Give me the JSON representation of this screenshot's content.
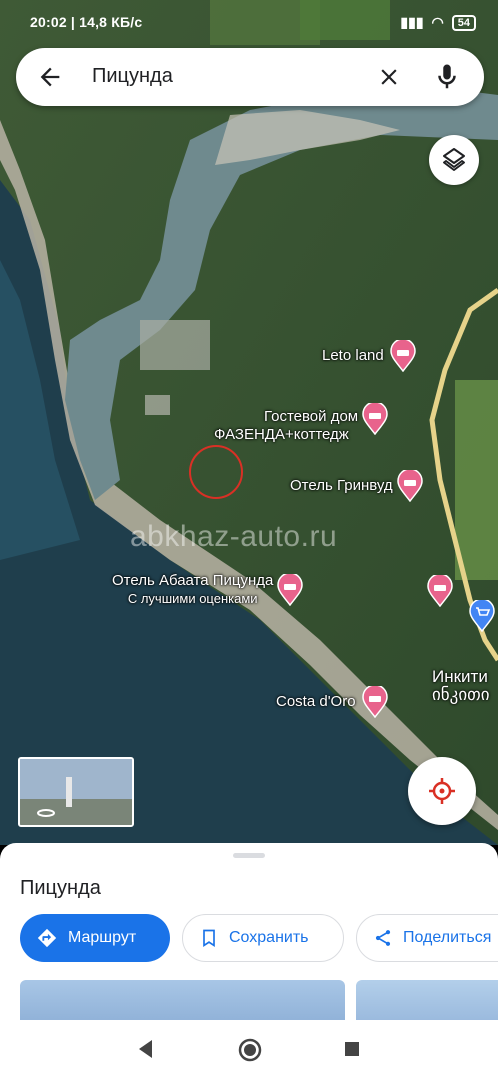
{
  "status_bar": {
    "time_and_speed": "20:02 | 14,8 КБ/с",
    "battery": "54"
  },
  "search": {
    "query": "Пицунда",
    "back_icon": "arrow-left-icon",
    "clear_icon": "close-icon",
    "mic_icon": "mic-icon"
  },
  "map": {
    "watermark": "abkhaz-auto.ru",
    "pois": [
      {
        "label": "Leto land",
        "type": "hotel"
      },
      {
        "label": "Гостевой дом",
        "label2": "ФАЗЕНДА+коттедж",
        "type": "hotel"
      },
      {
        "label": "Отель Гринвуд",
        "type": "hotel"
      },
      {
        "label": "Отель Абаата Пицунда",
        "label2": "С лучшими оценками",
        "type": "hotel"
      },
      {
        "label": "Costa d'Oro",
        "type": "hotel"
      },
      {
        "label": "Инкити",
        "label2": "ინკითი",
        "type": "place"
      }
    ]
  },
  "sheet": {
    "title": "Пицунда",
    "actions": {
      "route": "Маршрут",
      "save": "Сохранить",
      "share": "Поделиться"
    }
  },
  "colors": {
    "accent": "#1a73e8",
    "hotel_pin": "#e8638c",
    "location_target": "#d93025"
  }
}
